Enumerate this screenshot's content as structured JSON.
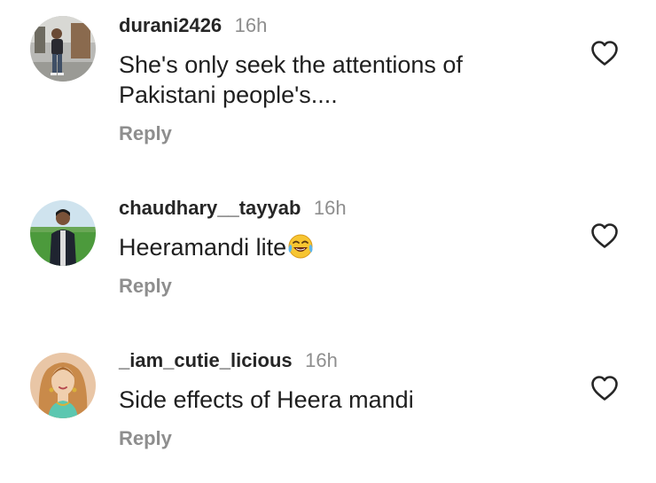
{
  "comments": [
    {
      "username": "durani2426",
      "time": "16h",
      "text": "She's only seek the attentions of Pakistani people's....",
      "reply_label": "Reply",
      "avatar_icon": "person-standing-outdoors-photo",
      "like_icon": "heart-outline-icon"
    },
    {
      "username": "chaudhary__tayyab",
      "time": "16h",
      "text": "Heeramandi lite",
      "emoji": "😂",
      "reply_label": "Reply",
      "avatar_icon": "man-in-field-photo",
      "like_icon": "heart-outline-icon"
    },
    {
      "username": "_iam_cutie_licious",
      "time": "16h",
      "text": "Side effects of Heera mandi",
      "reply_label": "Reply",
      "avatar_icon": "woman-portrait-photo",
      "like_icon": "heart-outline-icon"
    }
  ],
  "colors": {
    "username": "#262626",
    "secondary": "#8e8e8e",
    "body": "#1f1f1f",
    "background": "#ffffff"
  }
}
